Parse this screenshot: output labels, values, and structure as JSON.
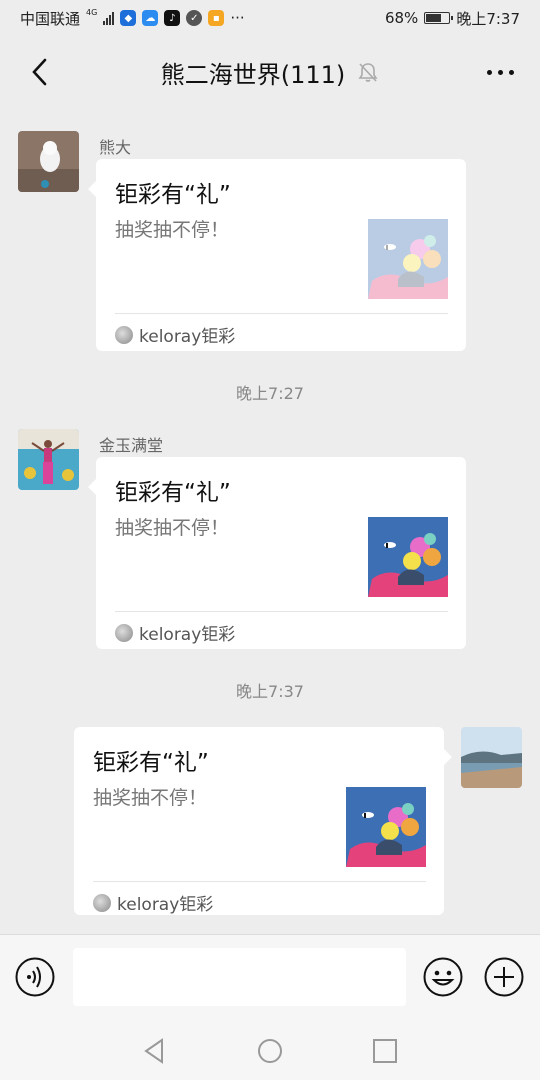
{
  "status_bar": {
    "carrier": "中国联通",
    "network": "4G",
    "battery_percent": "68%",
    "battery_level": 0.68,
    "time": "晚上7:37"
  },
  "nav": {
    "title": "熊二海世界(111)"
  },
  "messages": [
    {
      "sender": "熊大",
      "card": {
        "title": "钜彩有“礼”",
        "desc": "抽奖抽不停！",
        "source": "keloray钜彩"
      }
    },
    {
      "time": "晚上7:27",
      "sender": "金玉满堂",
      "card": {
        "title": "钜彩有“礼”",
        "desc": "抽奖抽不停！",
        "source": "keloray钜彩"
      }
    },
    {
      "time": "晚上7:37",
      "card": {
        "title": "钜彩有“礼”",
        "desc": "抽奖抽不停！",
        "source": "keloray钜彩"
      }
    }
  ],
  "input": {
    "value": "",
    "placeholder": ""
  },
  "icons": {
    "back": "back-arrow-icon",
    "mute": "bell-off-icon",
    "more": "more-dots-icon",
    "voice": "voice-icon",
    "emoji": "emoji-icon",
    "plus": "plus-icon"
  },
  "colors": {
    "background": "#ededed",
    "card": "#ffffff"
  }
}
